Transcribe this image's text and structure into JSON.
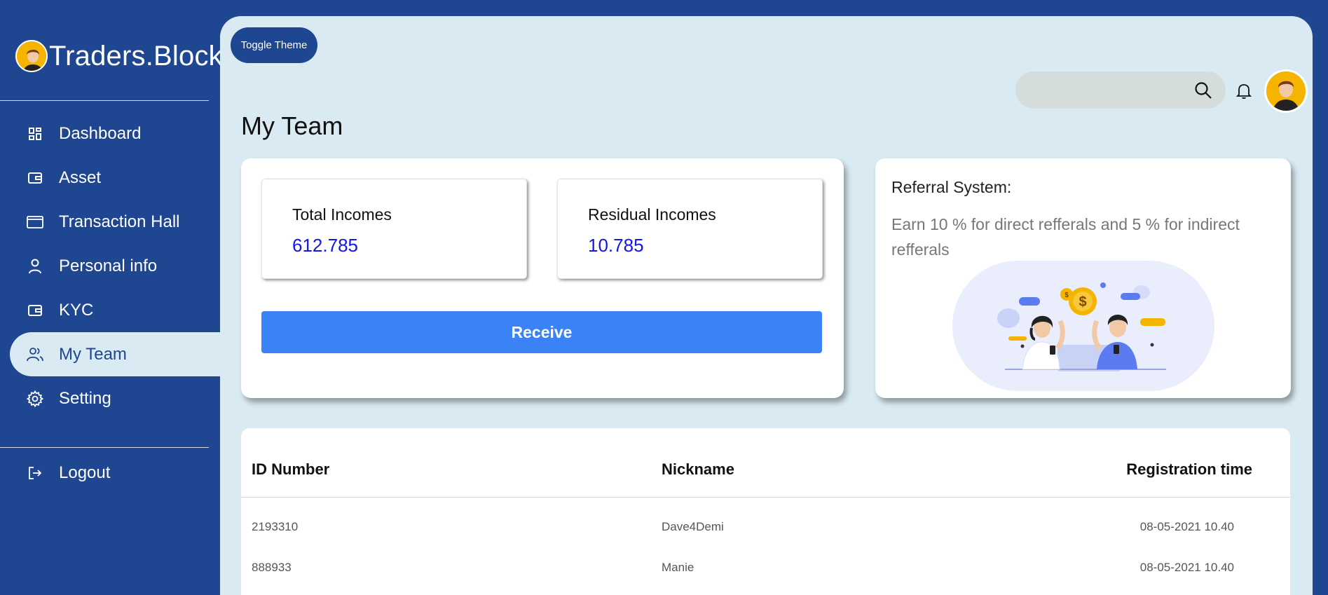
{
  "sidebar": {
    "brand": "Traders.Block",
    "items": [
      {
        "label": "Dashboard",
        "icon": "dashboard-icon"
      },
      {
        "label": "Asset",
        "icon": "wallet-icon"
      },
      {
        "label": "Transaction Hall",
        "icon": "card-icon"
      },
      {
        "label": "Personal info",
        "icon": "user-icon"
      },
      {
        "label": "KYC",
        "icon": "wallet-icon"
      },
      {
        "label": "My Team",
        "icon": "team-icon",
        "active": true
      },
      {
        "label": "Setting",
        "icon": "gear-icon"
      }
    ],
    "logout": "Logout"
  },
  "header": {
    "toggle_theme": "Toggle Theme",
    "search_placeholder": ""
  },
  "page": {
    "title": "My Team"
  },
  "incomes": {
    "total_label": "Total Incomes",
    "total_value": "612.785",
    "residual_label": "Residual Incomes",
    "residual_value": "10.785",
    "receive_label": "Receive"
  },
  "referral": {
    "title": "Referral System:",
    "description": "Earn 10 % for direct refferals and 5 % for indirect refferals"
  },
  "table": {
    "headers": [
      "ID Number",
      "Nickname",
      "Registration time"
    ],
    "rows": [
      [
        "2193310",
        "Dave4Demi",
        "08-05-2021 10.40"
      ],
      [
        "888933",
        "Manie",
        "08-05-2021 10.40"
      ]
    ]
  },
  "colors": {
    "brand_blue": "#1f4690",
    "content_bg": "#d9eaf2",
    "accent_button": "#3b82f6",
    "income_value": "#1515e6"
  }
}
